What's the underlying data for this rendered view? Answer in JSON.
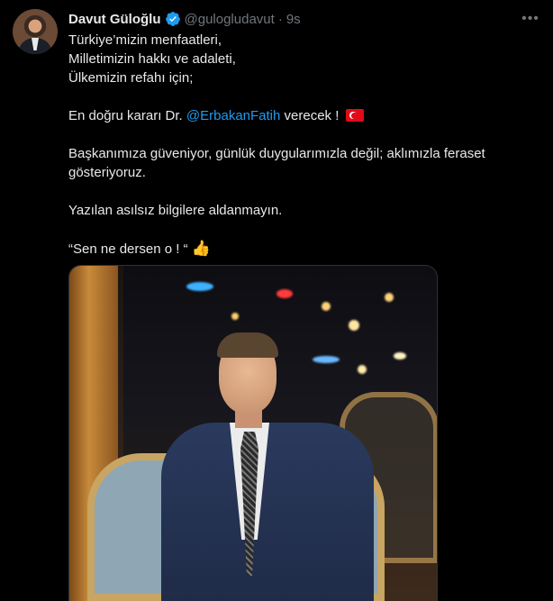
{
  "author": {
    "name": "Davut Güloğlu",
    "handle": "@gulogludavut",
    "time": "9s"
  },
  "tweet": {
    "line1": "Türkiye’mizin menfaatleri,",
    "line2": "Milletimizin hakkı ve adaleti,",
    "line3": "Ülkemizin refahı için;",
    "line4_prefix": "En doğru kararı Dr. ",
    "line4_mention": "@ErbakanFatih",
    "line4_suffix": " verecek ! ",
    "line5": "Başkanımıza güveniyor, günlük duygularımızla değil; aklımızla feraset gösteriyoruz.",
    "line6": "Yazılan asılsız bilgilere aldanmayın.",
    "line7": "“Sen ne dersen o ! “"
  },
  "icons": {
    "verified": "verified-badge-icon",
    "more": "more-options-icon",
    "flag": "turkey-flag-icon",
    "thumb": "thumbs-up-icon"
  },
  "colors": {
    "background": "#000000",
    "text": "#e7e9ea",
    "muted": "#71767b",
    "link": "#1d9bf0"
  }
}
